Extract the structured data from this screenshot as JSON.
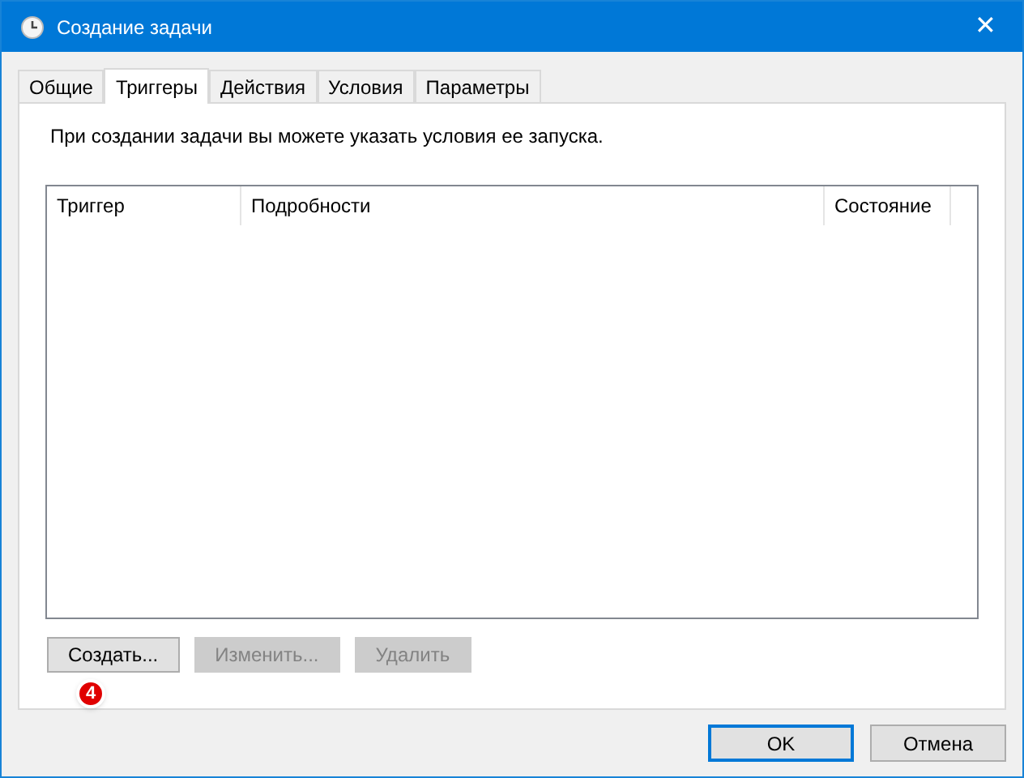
{
  "window": {
    "title": "Создание задачи",
    "close": "✕"
  },
  "tabs": [
    {
      "label": "Общие",
      "selected": false
    },
    {
      "label": "Триггеры",
      "selected": true
    },
    {
      "label": "Действия",
      "selected": false
    },
    {
      "label": "Условия",
      "selected": false
    },
    {
      "label": "Параметры",
      "selected": false
    }
  ],
  "intro": "При создании задачи вы можете указать условия ее запуска.",
  "table": {
    "columns": [
      "Триггер",
      "Подробности",
      "Состояние"
    ]
  },
  "buttons": [
    {
      "label": "Создать...",
      "disabled": false
    },
    {
      "label": "Изменить...",
      "disabled": true
    },
    {
      "label": "Удалить",
      "disabled": true
    }
  ],
  "step_badge": "4",
  "footer_buttons": [
    {
      "label": "OK",
      "default": true
    },
    {
      "label": "Отмена",
      "default": false
    }
  ]
}
